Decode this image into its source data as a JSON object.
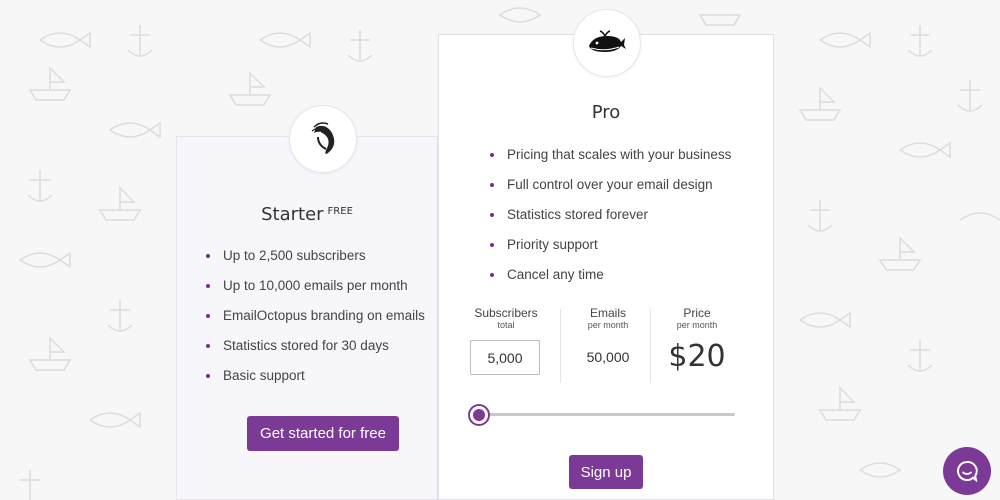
{
  "starter": {
    "title": "Starter",
    "badge": "FREE",
    "features": [
      "Up to 2,500 subscribers",
      "Up to 10,000 emails per month",
      "EmailOctopus branding on emails",
      "Statistics stored for 30 days",
      "Basic support"
    ],
    "cta_label": "Get started for free",
    "emblem_icon": "shrimp-icon"
  },
  "pro": {
    "title": "Pro",
    "features": [
      "Pricing that scales with your business",
      "Full control over your email design",
      "Statistics stored forever",
      "Priority support",
      "Cancel any time"
    ],
    "emblem_icon": "whale-icon",
    "calculator": {
      "subscribers_label": "Subscribers",
      "subscribers_sub": "total",
      "subscribers_value": "5,000",
      "emails_label": "Emails",
      "emails_sub": "per month",
      "emails_value": "50,000",
      "price_label": "Price",
      "price_sub": "per month",
      "price_value": "$20",
      "slider_fraction": 0.0
    },
    "cta_label": "Sign up"
  },
  "colors": {
    "accent": "#7b3a96",
    "bullet": "#7b2d8e"
  },
  "chat": {
    "icon": "chat-bubble-icon"
  }
}
